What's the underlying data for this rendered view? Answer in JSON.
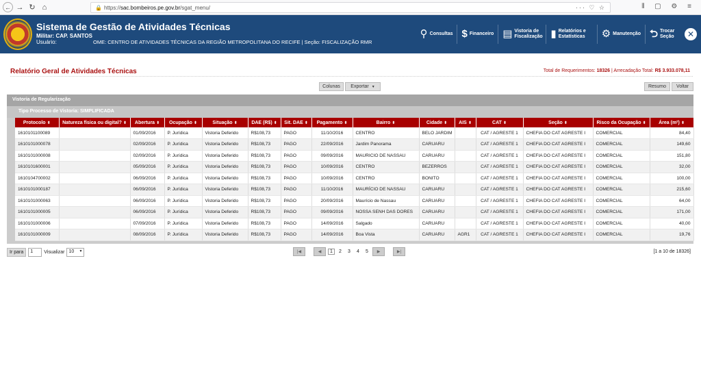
{
  "browser": {
    "url_host": "sac.bombeiros.pe.gov.br",
    "url_path": "/sgat_menu/",
    "prefix": "https://"
  },
  "header": {
    "title": "Sistema de Gestão de Atividades Técnicas",
    "military": "Militar: CAP. SANTOS",
    "user_label": "Usuário:",
    "ome": "OME: CENTRO DE ATIVIDADES TÉCNICAS DA REGIÃO METROPOLITANA DO RECIFE | Seção: FISCALIZAÇÃO RMR"
  },
  "nav": [
    {
      "icon": "search-icon",
      "glyph": "⚲",
      "label": "Consultas"
    },
    {
      "icon": "piggy-bank-icon",
      "glyph": "🐷",
      "label": "Financeiro"
    },
    {
      "icon": "clipboard-icon",
      "glyph": "▤",
      "label": "Vistoria de Fiscalização"
    },
    {
      "icon": "bar-chart-icon",
      "glyph": "▮",
      "label": "Relatórios e Estatísticas"
    },
    {
      "icon": "gears-icon",
      "glyph": "⚙",
      "label": "Manutenção"
    },
    {
      "icon": "back-arrow-icon",
      "glyph": "⮌",
      "label": "Trocar Seção"
    }
  ],
  "page": {
    "title": "Relatório Geral de Atividades Técnicas",
    "total_label": "Total de Requerimentos:",
    "total_value": "18326",
    "arrec_label": "| Arrecadação Total:",
    "arrec_value": "R$ 3.933.078,11"
  },
  "toolbar": {
    "colunas": "Colunas",
    "exportar": "Exportar",
    "resumo": "Resumo",
    "voltar": "Voltar"
  },
  "grid": {
    "caption": "Vistoria de Regularização",
    "group": "Tipo Processo de Vistoria: SIMPLIFICADA",
    "headers": [
      "Protocolo",
      "Natureza física ou digital?",
      "Abertura",
      "Ocupação",
      "Situação",
      "DAE (R$)",
      "Sit. DAE",
      "Pagamento",
      "Bairro",
      "Cidade",
      "AIS",
      "CAT",
      "Seção",
      "Risco da Ocupação",
      "Área (m²)"
    ],
    "rows": [
      [
        "1610101100089",
        "",
        "01/09/2016",
        "P. Jurídica",
        "Vistoria Deferido",
        "R$108,73",
        "PAGO",
        "11/10/2016",
        "CENTRO",
        "BELO JARDIM",
        "",
        "CAT / AGRESTE 1",
        "CHEFIA DO CAT AGRESTE I",
        "COMERCIAL",
        "84,40"
      ],
      [
        "1610101000078",
        "",
        "02/09/2016",
        "P. Jurídica",
        "Vistoria Deferido",
        "R$108,73",
        "PAGO",
        "22/09/2016",
        "Jardim Panorama",
        "CARUARU",
        "",
        "CAT / AGRESTE 1",
        "CHEFIA DO CAT AGRESTE I",
        "COMERCIAL",
        "149,60"
      ],
      [
        "1610101000008",
        "",
        "02/09/2016",
        "P. Jurídica",
        "Vistoria Deferido",
        "R$108,73",
        "PAGO",
        "09/09/2016",
        "MAURICIO DE NASSAU",
        "CARUARU",
        "",
        "CAT / AGRESTE 1",
        "CHEFIA DO CAT AGRESTE I",
        "COMERCIAL",
        "151,80"
      ],
      [
        "1610101600001",
        "",
        "05/09/2016",
        "P. Jurídica",
        "Vistoria Deferido",
        "R$108,73",
        "PAGO",
        "10/09/2016",
        "CENTRO",
        "BEZERROS",
        "",
        "CAT / AGRESTE 1",
        "CHEFIA DO CAT AGRESTE I",
        "COMERCIAL",
        "32,00"
      ],
      [
        "1610104700002",
        "",
        "06/09/2016",
        "P. Jurídica",
        "Vistoria Deferido",
        "R$108,73",
        "PAGO",
        "10/09/2016",
        "CENTRO",
        "BONITO",
        "",
        "CAT / AGRESTE 1",
        "CHEFIA DO CAT AGRESTE I",
        "COMERCIAL",
        "100,00"
      ],
      [
        "1610101000187",
        "",
        "06/09/2016",
        "P. Jurídica",
        "Vistoria Deferido",
        "R$108,73",
        "PAGO",
        "11/10/2016",
        "MAURÍCIO DE NASSAU",
        "CARUARU",
        "",
        "CAT / AGRESTE 1",
        "CHEFIA DO CAT AGRESTE I",
        "COMERCIAL",
        "215,60"
      ],
      [
        "1610101000063",
        "",
        "06/09/2016",
        "P. Jurídica",
        "Vistoria Deferido",
        "R$108,73",
        "PAGO",
        "20/09/2016",
        "Maurício de Nassau",
        "CARUARU",
        "",
        "CAT / AGRESTE 1",
        "CHEFIA DO CAT AGRESTE I",
        "COMERCIAL",
        "64,00"
      ],
      [
        "1610101000005",
        "",
        "06/09/2016",
        "P. Jurídica",
        "Vistoria Deferido",
        "R$108,73",
        "PAGO",
        "09/09/2016",
        "NOSSA SENH DAS DORES",
        "CARUARU",
        "",
        "CAT / AGRESTE 1",
        "CHEFIA DO CAT AGRESTE I",
        "COMERCIAL",
        "171,00"
      ],
      [
        "1610101000006",
        "",
        "07/09/2016",
        "P. Jurídica",
        "Vistoria Deferido",
        "R$108,73",
        "PAGO",
        "14/09/2016",
        "Salgado",
        "CARUARU",
        "",
        "CAT / AGRESTE 1",
        "CHEFIA DO CAT AGRESTE I",
        "COMERCIAL",
        "40,00"
      ],
      [
        "1610101000009",
        "",
        "08/09/2016",
        "P. Jurídica",
        "Vistoria Deferido",
        "R$108,73",
        "PAGO",
        "14/09/2016",
        "Boa Vista",
        "CARUARU",
        "AGR1",
        "CAT / AGRESTE 1",
        "CHEFIA DO CAT AGRESTE I",
        "COMERCIAL",
        "19,76"
      ]
    ]
  },
  "pager": {
    "goto": "Ir para",
    "goto_value": "1",
    "visualizar": "Visualizar",
    "page_size": "10",
    "pages": [
      "1",
      "2",
      "3",
      "4",
      "5"
    ],
    "range": "[1 a 10 de 18326]"
  }
}
